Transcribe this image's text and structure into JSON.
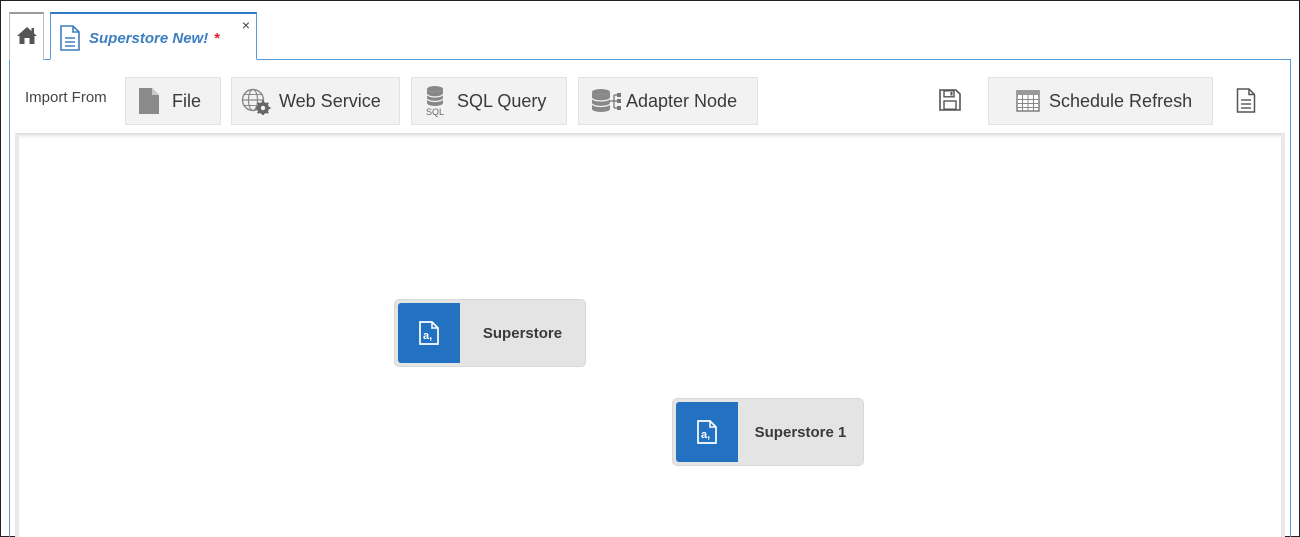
{
  "tabs": {
    "home_icon": "home-icon",
    "active": {
      "icon": "document-icon",
      "title": "Superstore New!",
      "dirty_marker": "*",
      "close_symbol": "×"
    }
  },
  "toolbar": {
    "import_label": "Import From",
    "buttons": [
      {
        "label": "File",
        "icon": "file-icon"
      },
      {
        "label": "Web Service",
        "icon": "web-service-icon"
      },
      {
        "label": "SQL Query",
        "icon": "sql-database-icon"
      },
      {
        "label": "Adapter Node",
        "icon": "adapter-node-icon"
      }
    ],
    "save_icon": "save-icon",
    "schedule_refresh": {
      "label": "Schedule Refresh",
      "icon": "calendar-grid-icon"
    },
    "properties_icon": "document-icon",
    "sql_icon_text": "SQL"
  },
  "canvas": {
    "nodes": [
      {
        "label": "Superstore",
        "icon": "data-file-icon"
      },
      {
        "label": "Superstore 1",
        "icon": "data-file-icon"
      }
    ]
  },
  "colors": {
    "accent": "#2372c1",
    "tab_title": "#3d7ec0",
    "dirty": "#d9232e",
    "button_bg": "#f2f2f2",
    "node_bg": "#e4e4e4"
  }
}
